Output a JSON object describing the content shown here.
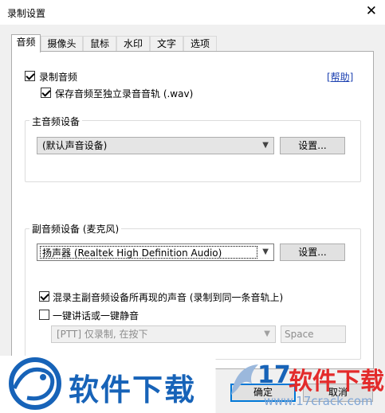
{
  "window": {
    "title": "录制设置",
    "close_glyph": "✕"
  },
  "tabs": [
    {
      "label": "音频",
      "active": true
    },
    {
      "label": "摄像头"
    },
    {
      "label": "鼠标"
    },
    {
      "label": "水印"
    },
    {
      "label": "文字"
    },
    {
      "label": "选项"
    }
  ],
  "audio": {
    "record_audio": {
      "label": "录制音频",
      "checked": true
    },
    "help_link": "[帮助]",
    "save_separate": {
      "label": "保存音频至独立录音音轨 (.wav)",
      "checked": true
    },
    "main_device": {
      "group_label": "主音频设备",
      "selected": "(默认声音设备)",
      "settings_label": "设置..."
    },
    "sub_device": {
      "group_label": "副音频设备 (麦克风)",
      "selected": "扬声器 (Realtek High Definition Audio)",
      "settings_label": "设置...",
      "mix": {
        "label": "混录主副音频设备所再现的声音 (录制到同一条音轨上)",
        "checked": true
      },
      "ptt": {
        "label": "一键讲话或一键静音",
        "checked": false
      },
      "ptt_mode": "[PTT] 仅录制, 在按下",
      "hotkey": "Space"
    }
  },
  "buttons": {
    "ok": "确定",
    "cancel": "取消"
  },
  "watermark": {
    "left_text": "软件下载",
    "brand_num": "17",
    "brand_text": "软件下载",
    "url": "www.17crack.com"
  },
  "icons": {
    "dropdown": "▼",
    "logo": "dragon-logo-icon"
  }
}
